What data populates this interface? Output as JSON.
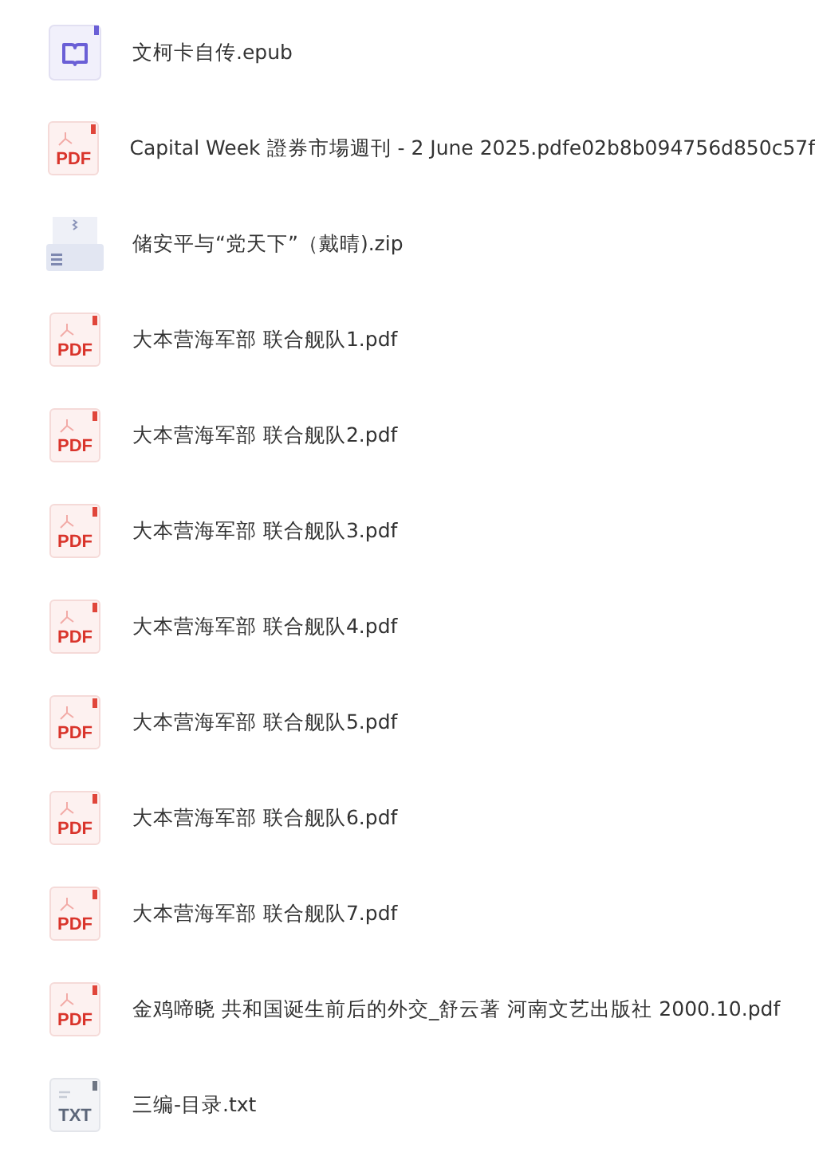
{
  "files": [
    {
      "name": "文柯卡自传.epub",
      "kind": "epub"
    },
    {
      "name": "Capital Week 證券市場週刊 - 2 June 2025.pdfe02b8b094756d850c57f",
      "kind": "pdf",
      "badge": "PDF"
    },
    {
      "name": "储安平与“党天下”（戴晴).zip",
      "kind": "zip"
    },
    {
      "name": "大本营海军部 联合舰队1.pdf",
      "kind": "pdf",
      "badge": "PDF"
    },
    {
      "name": "大本营海军部 联合舰队2.pdf",
      "kind": "pdf",
      "badge": "PDF"
    },
    {
      "name": "大本营海军部 联合舰队3.pdf",
      "kind": "pdf",
      "badge": "PDF"
    },
    {
      "name": "大本营海军部 联合舰队4.pdf",
      "kind": "pdf",
      "badge": "PDF"
    },
    {
      "name": "大本营海军部 联合舰队5.pdf",
      "kind": "pdf",
      "badge": "PDF"
    },
    {
      "name": "大本营海军部 联合舰队6.pdf",
      "kind": "pdf",
      "badge": "PDF"
    },
    {
      "name": "大本营海军部 联合舰队7.pdf",
      "kind": "pdf",
      "badge": "PDF"
    },
    {
      "name": "金鸡啼晓 共和国诞生前后的外交_舒云著 河南文艺出版社 2000.10.pdf",
      "kind": "pdf",
      "badge": "PDF"
    },
    {
      "name": "三编-目录.txt",
      "kind": "txt",
      "badge": "TXT"
    }
  ]
}
